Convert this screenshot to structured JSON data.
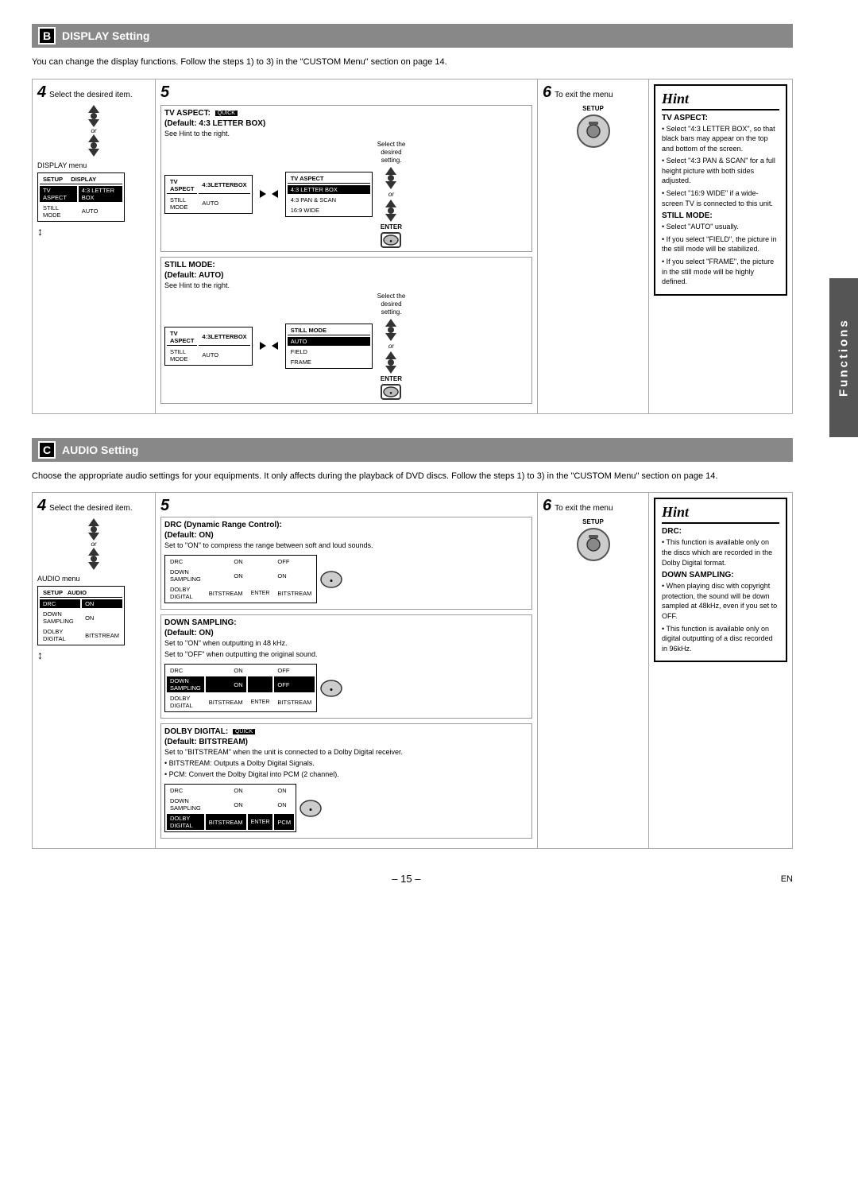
{
  "sections": {
    "B": {
      "letter": "B",
      "title": "DISPLAY Setting",
      "description": "You can change the display functions. Follow the steps 1) to 3) in the \"CUSTOM Menu\" section on page 14.",
      "steps": {
        "step4": {
          "label": "4",
          "text": "Select the desired item.",
          "menu_name": "DISPLAY menu",
          "menu_title_label": "SETUP",
          "menu_tab": "DISPLAY",
          "menu_rows": [
            {
              "label": "TV ASPECT",
              "value": "4:3 LETTER BOX",
              "selected": true
            },
            {
              "label": "STILL MODE",
              "value": "AUTO"
            }
          ]
        },
        "step5": {
          "label": "5",
          "settings": [
            {
              "name": "TV ASPECT:",
              "badge": "QUICK",
              "default": "(Default: 4:3 LETTER BOX)",
              "desc": "See Hint to the right.",
              "screen1": {
                "title_left": "TV ASPECT",
                "rows": [
                  {
                    "left": "4:3 LETTER BOX",
                    "selected": true
                  },
                  {
                    "left": "4:3 PAN & SCAN"
                  },
                  {
                    "left": "16:9 WIDE"
                  }
                ]
              }
            },
            {
              "name": "STILL MODE:",
              "badge": "",
              "default": "(Default: AUTO)",
              "desc": "See Hint to the right.",
              "screen1": {
                "title_left": "STILL MODE",
                "rows": [
                  {
                    "left": "AUTO",
                    "selected": true
                  },
                  {
                    "left": "FIELD"
                  },
                  {
                    "left": "FRAME"
                  }
                ]
              }
            }
          ]
        },
        "step6": {
          "label": "6",
          "text": "To exit the menu",
          "setup_label": "SETUP"
        }
      },
      "hint": {
        "title": "Hint",
        "sections": [
          {
            "subtitle": "TV ASPECT:",
            "bullets": [
              "Select \"4:3 LETTER BOX\", so that black bars may appear on the top and bottom of the screen.",
              "Select \"4:3 PAN & SCAN\" for a full height picture with both sides adjusted.",
              "Select \"16:9 WIDE\" if a wide-screen TV is connected to this unit."
            ]
          },
          {
            "subtitle": "STILL MODE:",
            "bullets": [
              "Select \"AUTO\" usually.",
              "If you select \"FIELD\", the picture in the still mode will be stabilized.",
              "If you select \"FRAME\", the picture in the still mode will be highly defined."
            ]
          }
        ]
      }
    },
    "C": {
      "letter": "C",
      "title": "AUDIO Setting",
      "description": "Choose the appropriate audio settings for your equipments. It only affects during the playback of DVD discs. Follow the steps 1) to 3) in the \"CUSTOM Menu\" section on page 14.",
      "steps": {
        "step4": {
          "label": "4",
          "text": "Select the desired item.",
          "menu_name": "AUDIO menu",
          "menu_title_label": "SETUP",
          "menu_tab": "AUDIO",
          "menu_rows": [
            {
              "label": "DRC",
              "value": "ON",
              "selected": true
            },
            {
              "label": "DOWN SAMPLING",
              "value": "ON"
            },
            {
              "label": "DOLBY DIGITAL",
              "value": "BITSTREAM"
            }
          ]
        },
        "step5": {
          "label": "5",
          "settings": [
            {
              "name": "DRC (Dynamic Range Control):",
              "badge": "",
              "default": "(Default: ON)",
              "desc": "Set to \"ON\" to compress the range between soft and loud sounds.",
              "screen1": {
                "rows_display": [
                  {
                    "left": "DRC",
                    "mid": "ON",
                    "right": "OFF"
                  },
                  {
                    "left": "DOWN SAMPLING",
                    "mid": "ON",
                    "right": "ON"
                  },
                  {
                    "left": "DOLBY DIGITAL",
                    "mid": "BITSTREAM",
                    "right": "BITSTREAM"
                  }
                ]
              }
            },
            {
              "name": "DOWN SAMPLING:",
              "badge": "",
              "default": "(Default: ON)",
              "desc1": "Set to \"ON\" when outputting in 48 kHz.",
              "desc2": "Set to \"OFF\" when outputting the original sound.",
              "screen1": {
                "rows_display": [
                  {
                    "left": "DRC",
                    "mid": "ON",
                    "right": "OFF"
                  },
                  {
                    "left": "DOWN SAMPLING",
                    "mid": "ON",
                    "right": "OFF",
                    "selected_right": true
                  },
                  {
                    "left": "DOLBY DIGITAL",
                    "mid": "BITSTREAM",
                    "right": "BITSTREAM"
                  }
                ]
              }
            },
            {
              "name": "DOLBY DIGITAL:",
              "badge": "QUICK",
              "default": "(Default: BITSTREAM)",
              "desc_main": "Set to \"BITSTREAM\" when the unit is connected to a Dolby Digital receiver.",
              "bullets": [
                "BITSTREAM: Outputs a Dolby Digital Signals.",
                "PCM: Convert the Dolby Digital into PCM (2 channel)."
              ],
              "screen1": {
                "rows_display": [
                  {
                    "left": "DRC",
                    "mid": "ON",
                    "right": "ON"
                  },
                  {
                    "left": "DOWN SAMPLING",
                    "mid": "ON",
                    "right": "ON"
                  },
                  {
                    "left": "DOLBY DIGITAL",
                    "mid": "BITSTREAM",
                    "right": "PCM"
                  }
                ]
              }
            }
          ]
        },
        "step6": {
          "label": "6",
          "text": "To exit the menu",
          "setup_label": "SETUP"
        }
      },
      "hint": {
        "title": "Hint",
        "sections": [
          {
            "subtitle": "DRC:",
            "bullets": [
              "This function is available only on the discs which are recorded in the Dolby Digital format."
            ]
          },
          {
            "subtitle": "DOWN SAMPLING:",
            "bullets": [
              "When playing disc with copyright protection, the sound will be down sampled at 48kHz, even if you set to OFF.",
              "This function is available only on digital outputting of a disc recorded in 96kHz."
            ]
          }
        ]
      }
    }
  },
  "functions_label": "Functions",
  "page_number": "– 15 –",
  "en_label": "EN"
}
